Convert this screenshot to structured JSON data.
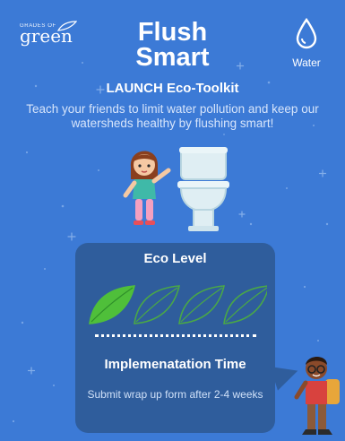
{
  "logo": {
    "small": "GRADES OF",
    "big": "green"
  },
  "title": {
    "line1": "Flush",
    "line2": "Smart"
  },
  "category": {
    "label": "Water",
    "icon": "water-drop-icon"
  },
  "subtitle": "LAUNCH Eco-Toolkit",
  "description": "Teach your friends to limit water pollution and keep our watersheds healthy by flushing smart!",
  "eco_level": {
    "heading": "Eco Level",
    "level": 1,
    "max": 4
  },
  "implementation": {
    "heading": "Implemenatation Time",
    "text": "Submit wrap up form after 2-4 weeks"
  },
  "colors": {
    "background": "#3c7ad6",
    "panel": "#2f5d9c",
    "leaf_active": "#4fbf3a",
    "leaf_outline": "#4aa846"
  }
}
